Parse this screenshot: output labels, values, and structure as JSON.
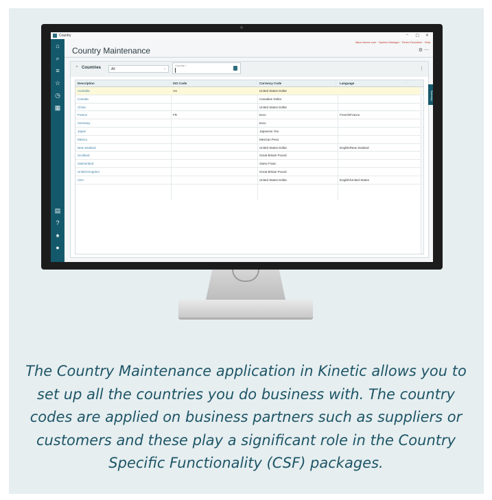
{
  "app": {
    "window_title": "Country",
    "util_links": "https://acme.com  ·  System Manager  ·  Demo Education  ·  Help",
    "page_title": "Country Maintenance",
    "header_icons": "⚙  ⋯",
    "side_tab_label": "Summary"
  },
  "panel": {
    "label": "Countries",
    "filter_value": "All",
    "search_placeholder": "Country *"
  },
  "grid": {
    "columns": [
      "Description",
      "ISO Code",
      "Currency Code",
      "Language"
    ],
    "rows": [
      [
        "Australia",
        "AU",
        "United States Dollar",
        ""
      ],
      [
        "Canada",
        "",
        "Canadian Dollar",
        ""
      ],
      [
        "China",
        "",
        "United States Dollar",
        ""
      ],
      [
        "France",
        "FR",
        "Euro",
        "French/France"
      ],
      [
        "Germany",
        "",
        "Euro",
        ""
      ],
      [
        "Japan",
        "",
        "Japanese Yen",
        ""
      ],
      [
        "Mexico",
        "",
        "Mexican Peso",
        ""
      ],
      [
        "New Zealand",
        "",
        "United States Dollar",
        "English/New Zealand"
      ],
      [
        "Scotland",
        "",
        "Great Britain Pound",
        ""
      ],
      [
        "Switzerland",
        "",
        "Swiss Franc",
        ""
      ],
      [
        "United Kingdom",
        "",
        "Great Britain Pound",
        ""
      ],
      [
        "USA",
        "",
        "United States Dollar",
        "English/United States"
      ]
    ]
  },
  "nav_icons": [
    "home-icon",
    "search-icon",
    "menu-icon",
    "star-icon",
    "history-icon",
    "dashboard-icon",
    "chat-icon",
    "help-icon",
    "bell-icon",
    "user-icon"
  ],
  "caption": "The Country Maintenance application in Kinetic allows you to set up all the countries you do business with. The country codes are applied on business partners such as suppliers or customers and these play a significant role in the Country Specific Functionality (CSF) packages.",
  "colors": {
    "nav": "#14596b",
    "caption": "#1e5566",
    "link": "#3b7fa6",
    "selected_row": "#fdf8d8"
  }
}
